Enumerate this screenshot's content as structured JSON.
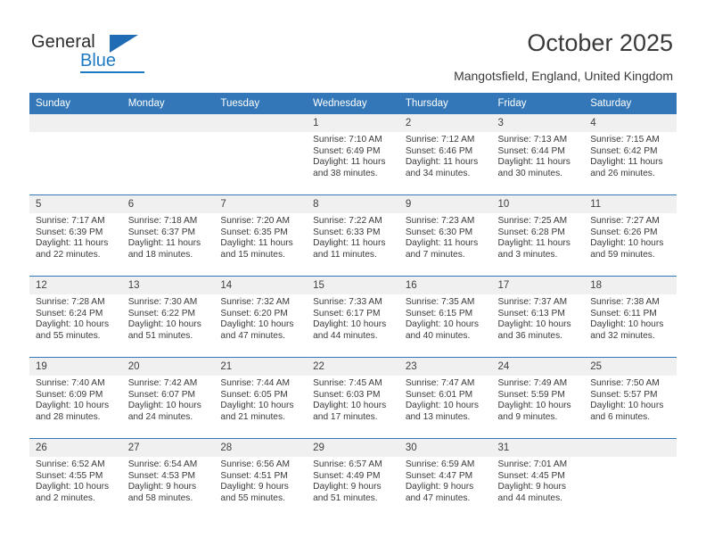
{
  "brand": {
    "name_top": "General",
    "name_bottom": "Blue",
    "accent_color": "#1f7ac4"
  },
  "header": {
    "title": "October 2025",
    "subtitle": "Mangotsfield, England, United Kingdom",
    "header_bg_color": "#3377b8",
    "daynum_bg_color": "#f0f0f0"
  },
  "weekday_headers": [
    "Sunday",
    "Monday",
    "Tuesday",
    "Wednesday",
    "Thursday",
    "Friday",
    "Saturday"
  ],
  "labels": {
    "sunrise_prefix": "Sunrise: ",
    "sunset_prefix": "Sunset: ",
    "daylight_prefix": "Daylight: "
  },
  "weeks": [
    [
      {
        "day": "",
        "empty": true
      },
      {
        "day": "",
        "empty": true
      },
      {
        "day": "",
        "empty": true
      },
      {
        "day": "1",
        "sunrise": "Sunrise: 7:10 AM",
        "sunset": "Sunset: 6:49 PM",
        "daylight": "Daylight: 11 hours and 38 minutes."
      },
      {
        "day": "2",
        "sunrise": "Sunrise: 7:12 AM",
        "sunset": "Sunset: 6:46 PM",
        "daylight": "Daylight: 11 hours and 34 minutes."
      },
      {
        "day": "3",
        "sunrise": "Sunrise: 7:13 AM",
        "sunset": "Sunset: 6:44 PM",
        "daylight": "Daylight: 11 hours and 30 minutes."
      },
      {
        "day": "4",
        "sunrise": "Sunrise: 7:15 AM",
        "sunset": "Sunset: 6:42 PM",
        "daylight": "Daylight: 11 hours and 26 minutes."
      }
    ],
    [
      {
        "day": "5",
        "sunrise": "Sunrise: 7:17 AM",
        "sunset": "Sunset: 6:39 PM",
        "daylight": "Daylight: 11 hours and 22 minutes."
      },
      {
        "day": "6",
        "sunrise": "Sunrise: 7:18 AM",
        "sunset": "Sunset: 6:37 PM",
        "daylight": "Daylight: 11 hours and 18 minutes."
      },
      {
        "day": "7",
        "sunrise": "Sunrise: 7:20 AM",
        "sunset": "Sunset: 6:35 PM",
        "daylight": "Daylight: 11 hours and 15 minutes."
      },
      {
        "day": "8",
        "sunrise": "Sunrise: 7:22 AM",
        "sunset": "Sunset: 6:33 PM",
        "daylight": "Daylight: 11 hours and 11 minutes."
      },
      {
        "day": "9",
        "sunrise": "Sunrise: 7:23 AM",
        "sunset": "Sunset: 6:30 PM",
        "daylight": "Daylight: 11 hours and 7 minutes."
      },
      {
        "day": "10",
        "sunrise": "Sunrise: 7:25 AM",
        "sunset": "Sunset: 6:28 PM",
        "daylight": "Daylight: 11 hours and 3 minutes."
      },
      {
        "day": "11",
        "sunrise": "Sunrise: 7:27 AM",
        "sunset": "Sunset: 6:26 PM",
        "daylight": "Daylight: 10 hours and 59 minutes."
      }
    ],
    [
      {
        "day": "12",
        "sunrise": "Sunrise: 7:28 AM",
        "sunset": "Sunset: 6:24 PM",
        "daylight": "Daylight: 10 hours and 55 minutes."
      },
      {
        "day": "13",
        "sunrise": "Sunrise: 7:30 AM",
        "sunset": "Sunset: 6:22 PM",
        "daylight": "Daylight: 10 hours and 51 minutes."
      },
      {
        "day": "14",
        "sunrise": "Sunrise: 7:32 AM",
        "sunset": "Sunset: 6:20 PM",
        "daylight": "Daylight: 10 hours and 47 minutes."
      },
      {
        "day": "15",
        "sunrise": "Sunrise: 7:33 AM",
        "sunset": "Sunset: 6:17 PM",
        "daylight": "Daylight: 10 hours and 44 minutes."
      },
      {
        "day": "16",
        "sunrise": "Sunrise: 7:35 AM",
        "sunset": "Sunset: 6:15 PM",
        "daylight": "Daylight: 10 hours and 40 minutes."
      },
      {
        "day": "17",
        "sunrise": "Sunrise: 7:37 AM",
        "sunset": "Sunset: 6:13 PM",
        "daylight": "Daylight: 10 hours and 36 minutes."
      },
      {
        "day": "18",
        "sunrise": "Sunrise: 7:38 AM",
        "sunset": "Sunset: 6:11 PM",
        "daylight": "Daylight: 10 hours and 32 minutes."
      }
    ],
    [
      {
        "day": "19",
        "sunrise": "Sunrise: 7:40 AM",
        "sunset": "Sunset: 6:09 PM",
        "daylight": "Daylight: 10 hours and 28 minutes."
      },
      {
        "day": "20",
        "sunrise": "Sunrise: 7:42 AM",
        "sunset": "Sunset: 6:07 PM",
        "daylight": "Daylight: 10 hours and 24 minutes."
      },
      {
        "day": "21",
        "sunrise": "Sunrise: 7:44 AM",
        "sunset": "Sunset: 6:05 PM",
        "daylight": "Daylight: 10 hours and 21 minutes."
      },
      {
        "day": "22",
        "sunrise": "Sunrise: 7:45 AM",
        "sunset": "Sunset: 6:03 PM",
        "daylight": "Daylight: 10 hours and 17 minutes."
      },
      {
        "day": "23",
        "sunrise": "Sunrise: 7:47 AM",
        "sunset": "Sunset: 6:01 PM",
        "daylight": "Daylight: 10 hours and 13 minutes."
      },
      {
        "day": "24",
        "sunrise": "Sunrise: 7:49 AM",
        "sunset": "Sunset: 5:59 PM",
        "daylight": "Daylight: 10 hours and 9 minutes."
      },
      {
        "day": "25",
        "sunrise": "Sunrise: 7:50 AM",
        "sunset": "Sunset: 5:57 PM",
        "daylight": "Daylight: 10 hours and 6 minutes."
      }
    ],
    [
      {
        "day": "26",
        "sunrise": "Sunrise: 6:52 AM",
        "sunset": "Sunset: 4:55 PM",
        "daylight": "Daylight: 10 hours and 2 minutes."
      },
      {
        "day": "27",
        "sunrise": "Sunrise: 6:54 AM",
        "sunset": "Sunset: 4:53 PM",
        "daylight": "Daylight: 9 hours and 58 minutes."
      },
      {
        "day": "28",
        "sunrise": "Sunrise: 6:56 AM",
        "sunset": "Sunset: 4:51 PM",
        "daylight": "Daylight: 9 hours and 55 minutes."
      },
      {
        "day": "29",
        "sunrise": "Sunrise: 6:57 AM",
        "sunset": "Sunset: 4:49 PM",
        "daylight": "Daylight: 9 hours and 51 minutes."
      },
      {
        "day": "30",
        "sunrise": "Sunrise: 6:59 AM",
        "sunset": "Sunset: 4:47 PM",
        "daylight": "Daylight: 9 hours and 47 minutes."
      },
      {
        "day": "31",
        "sunrise": "Sunrise: 7:01 AM",
        "sunset": "Sunset: 4:45 PM",
        "daylight": "Daylight: 9 hours and 44 minutes."
      },
      {
        "day": "",
        "empty": true
      }
    ]
  ]
}
